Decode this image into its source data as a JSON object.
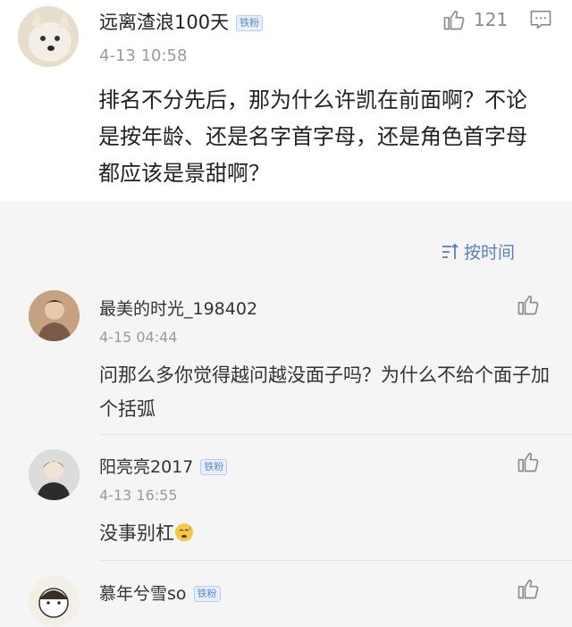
{
  "main_post": {
    "username": "远离渣浪100天",
    "badge": "铁粉",
    "timestamp": "4-13 10:58",
    "text": "排名不分先后，那为什么许凯在前面啊？不论是按年龄、还是名字首字母，还是角色首字母都应该是景甜啊？",
    "like_count": "121",
    "like_icon": "thumbs-up-icon",
    "comment_icon": "comment-icon"
  },
  "sort": {
    "label": "按时间",
    "icon": "sort-icon"
  },
  "replies": [
    {
      "username": "最美的时光_198402",
      "timestamp": "4-15 04:44",
      "text": "问那么多你觉得越问越没面子吗？为什么不给个面子加个括弧",
      "like_icon": "thumbs-up-icon"
    },
    {
      "username": "阳亮亮2017",
      "badge": "铁粉",
      "timestamp": "4-13 16:55",
      "text": "没事别杠",
      "emoji": "sweat-face-emoji",
      "like_icon": "thumbs-up-icon"
    },
    {
      "username": "慕年兮雪so",
      "badge": "铁粉",
      "like_icon": "thumbs-up-icon"
    }
  ],
  "colors": {
    "link_blue": "#5a7eb8",
    "badge_blue": "#5b86c9",
    "muted_gray": "#9a9a9a",
    "background": "#f5f5f5"
  }
}
